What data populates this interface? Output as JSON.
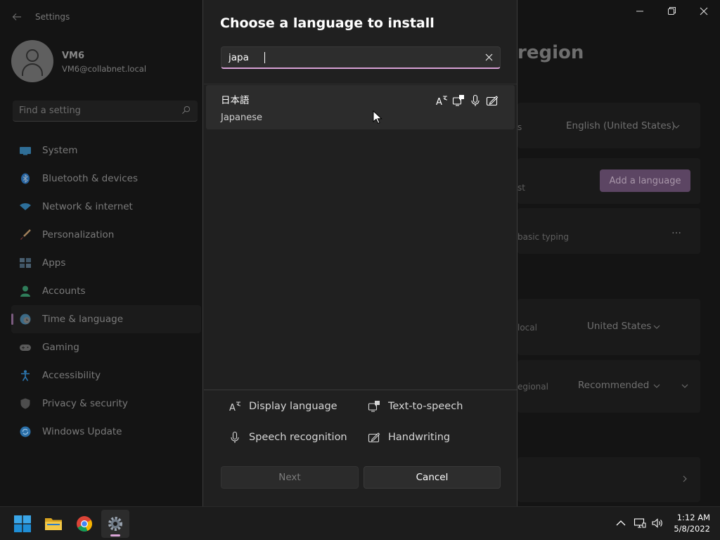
{
  "settings": {
    "app_title": "Settings",
    "profile": {
      "name": "VM6",
      "email": "VM6@collabnet.local"
    },
    "search_placeholder": "Find a setting",
    "nav": [
      {
        "label": "System",
        "icon": "system-icon"
      },
      {
        "label": "Bluetooth & devices",
        "icon": "bluetooth-icon"
      },
      {
        "label": "Network & internet",
        "icon": "wifi-icon"
      },
      {
        "label": "Personalization",
        "icon": "brush-icon"
      },
      {
        "label": "Apps",
        "icon": "apps-icon"
      },
      {
        "label": "Accounts",
        "icon": "person-icon"
      },
      {
        "label": "Time & language",
        "icon": "globe-clock-icon",
        "selected": true
      },
      {
        "label": "Gaming",
        "icon": "gamepad-icon"
      },
      {
        "label": "Accessibility",
        "icon": "accessibility-icon"
      },
      {
        "label": "Privacy & security",
        "icon": "shield-icon"
      },
      {
        "label": "Windows Update",
        "icon": "update-icon"
      }
    ],
    "page_title_fragment": "region",
    "display_language_value": "English (United States)",
    "display_language_label_fragment": "s",
    "add_language_label": "Add a language",
    "preferred_fragment": "st",
    "typing_fragment": "basic typing",
    "more_label": "…",
    "country_fragment": "local",
    "country_value": "United States",
    "regional_fragment": "egional",
    "regional_value": "Recommended"
  },
  "dialog": {
    "title": "Choose a language to install",
    "search_value": "japa",
    "result": {
      "native_name": "日本語",
      "english_name": "Japanese",
      "features": [
        "display-language-icon",
        "text-to-speech-icon",
        "speech-recognition-icon",
        "handwriting-icon"
      ]
    },
    "legend": {
      "display_language": "Display language",
      "text_to_speech": "Text-to-speech",
      "speech_recognition": "Speech recognition",
      "handwriting": "Handwriting"
    },
    "next_label": "Next",
    "cancel_label": "Cancel"
  },
  "taskbar": {
    "time": "1:12 AM",
    "date": "5/8/2022"
  },
  "colors": {
    "accent": "#d8a1d6",
    "add_button": "#5c4563",
    "dialog_bg": "#202020",
    "result_bg": "#2c2c2c"
  }
}
